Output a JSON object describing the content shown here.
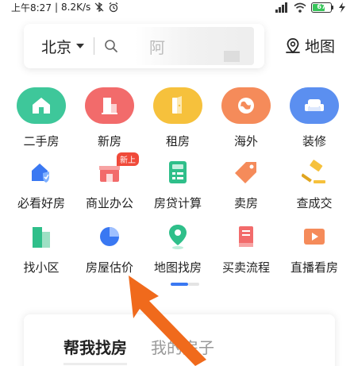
{
  "status_bar": {
    "time": "上午8:27",
    "speed": "8.2K/s",
    "battery": "67"
  },
  "search": {
    "city": "北京",
    "placeholder_fragment": "阿",
    "map_label": "地图"
  },
  "row1": [
    {
      "label": "二手房",
      "color": "#3ec79a",
      "icon": "house-icon"
    },
    {
      "label": "新房",
      "color": "#f26b6b",
      "icon": "building-icon"
    },
    {
      "label": "租房",
      "color": "#f6c13c",
      "icon": "door-icon"
    },
    {
      "label": "海外",
      "color": "#f58b5a",
      "icon": "globe-icon"
    },
    {
      "label": "装修",
      "color": "#5b8ff0",
      "icon": "sofa-icon"
    }
  ],
  "row2": [
    {
      "label": "必看好房",
      "icon": "house-shield-icon"
    },
    {
      "label": "商业办公",
      "icon": "shop-icon",
      "badge": "新上"
    },
    {
      "label": "房贷计算",
      "icon": "calculator-icon"
    },
    {
      "label": "卖房",
      "icon": "tag-icon"
    },
    {
      "label": "查成交",
      "icon": "gavel-icon"
    }
  ],
  "row3": [
    {
      "label": "找小区",
      "icon": "community-icon"
    },
    {
      "label": "房屋估价",
      "icon": "pie-chart-icon"
    },
    {
      "label": "地图找房",
      "icon": "map-pin-icon"
    },
    {
      "label": "买卖流程",
      "icon": "book-icon"
    },
    {
      "label": "直播看房",
      "icon": "video-icon"
    }
  ],
  "card": {
    "tab_active": "帮我找房",
    "tab_other": "我的房子"
  },
  "colors": {
    "accent_blue": "#3a78f2",
    "arrow_orange": "#f06a1c"
  }
}
